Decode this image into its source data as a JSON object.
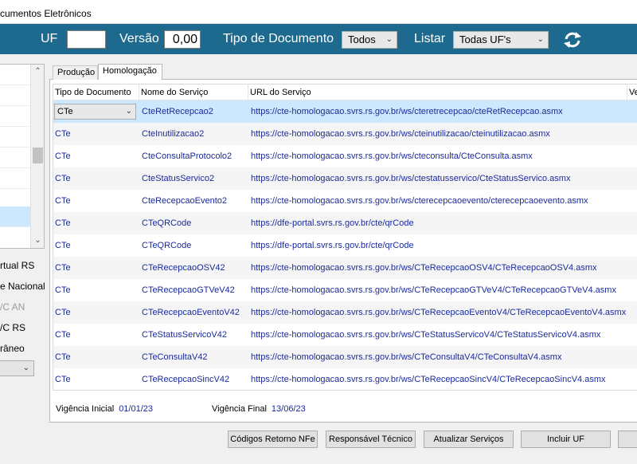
{
  "window": {
    "title": "cumentos Eletrônicos"
  },
  "filter": {
    "uf_label": "UF",
    "uf_value": "",
    "versao_label": "Versão",
    "versao_value": "0,00",
    "tipo_label": "Tipo de Documento",
    "tipo_value": "Todos",
    "listar_label": "Listar",
    "listar_value": "Todas UF's"
  },
  "left_options": [
    "rtual RS",
    "e Nacional",
    "/C AN",
    "/C RS",
    "râneo"
  ],
  "tabs": [
    {
      "label": "Produção"
    },
    {
      "label": "Homologação"
    }
  ],
  "grid": {
    "headers": [
      "Tipo de Documento",
      "Nome do Serviço",
      "URL do Serviço",
      "Ve"
    ],
    "rows": [
      {
        "tipo": "CTe",
        "nome": "CteRetRecepcao2",
        "url": "https://cte-homologacao.svrs.rs.gov.br/ws/cteretrecepcao/cteRetRecepcao.asmx"
      },
      {
        "tipo": "CTe",
        "nome": "CteInutilizacao2",
        "url": "https://cte-homologacao.svrs.rs.gov.br/ws/cteinutilizacao/cteinutilizacao.asmx"
      },
      {
        "tipo": "CTe",
        "nome": "CteConsultaProtocolo2",
        "url": "https://cte-homologacao.svrs.rs.gov.br/ws/cteconsulta/CteConsulta.asmx"
      },
      {
        "tipo": "CTe",
        "nome": "CteStatusServico2",
        "url": "https://cte-homologacao.svrs.rs.gov.br/ws/ctestatusservico/CteStatusServico.asmx"
      },
      {
        "tipo": "CTe",
        "nome": "CteRecepcaoEvento2",
        "url": "https://cte-homologacao.svrs.rs.gov.br/ws/cterecepcaoevento/cterecepcaoevento.asmx"
      },
      {
        "tipo": "CTe",
        "nome": "CTeQRCode",
        "url": "https://dfe-portal.svrs.rs.gov.br/cte/qrCode"
      },
      {
        "tipo": "CTe",
        "nome": "CTeQRCode",
        "url": "https://dfe-portal.svrs.rs.gov.br/cte/qrCode"
      },
      {
        "tipo": "CTe",
        "nome": "CTeRecepcaoOSV42",
        "url": "https://cte-homologacao.svrs.rs.gov.br/ws/CTeRecepcaoOSV4/CTeRecepcaoOSV4.asmx"
      },
      {
        "tipo": "CTe",
        "nome": "CTeRecepcaoGTVeV42",
        "url": "https://cte-homologacao.svrs.rs.gov.br/ws/CTeRecepcaoGTVeV4/CTeRecepcaoGTVeV4.asmx"
      },
      {
        "tipo": "CTe",
        "nome": "CTeRecepcaoEventoV42",
        "url": "https://cte-homologacao.svrs.rs.gov.br/ws/CTeRecepcaoEventoV4/CTeRecepcaoEventoV4.asmx"
      },
      {
        "tipo": "CTe",
        "nome": "CTeStatusServicoV42",
        "url": "https://cte-homologacao.svrs.rs.gov.br/ws/CTeStatusServicoV4/CTeStatusServicoV4.asmx"
      },
      {
        "tipo": "CTe",
        "nome": "CTeConsultaV42",
        "url": "https://cte-homologacao.svrs.rs.gov.br/ws/CTeConsultaV4/CTeConsultaV4.asmx"
      },
      {
        "tipo": "CTe",
        "nome": "CTeRecepcaoSincV42",
        "url": "https://cte-homologacao.svrs.rs.gov.br/ws/CTeRecepcaoSincV4/CTeRecepcaoSincV4.asmx"
      }
    ]
  },
  "vigencia": {
    "inicial_label": "Vigência Inicial",
    "inicial_value": "01/01/23",
    "final_label": "Vigência Final",
    "final_value": "13/06/23"
  },
  "buttons": {
    "codigos": "Códigos Retorno NFe",
    "responsavel": "Responsável Técnico",
    "atualizar": "Atualizar Serviços",
    "incluir": "Incluir UF"
  },
  "colors": {
    "header_bar": "#1e6a8e",
    "selection": "#cce8ff",
    "link_text": "#1a2a9c"
  }
}
